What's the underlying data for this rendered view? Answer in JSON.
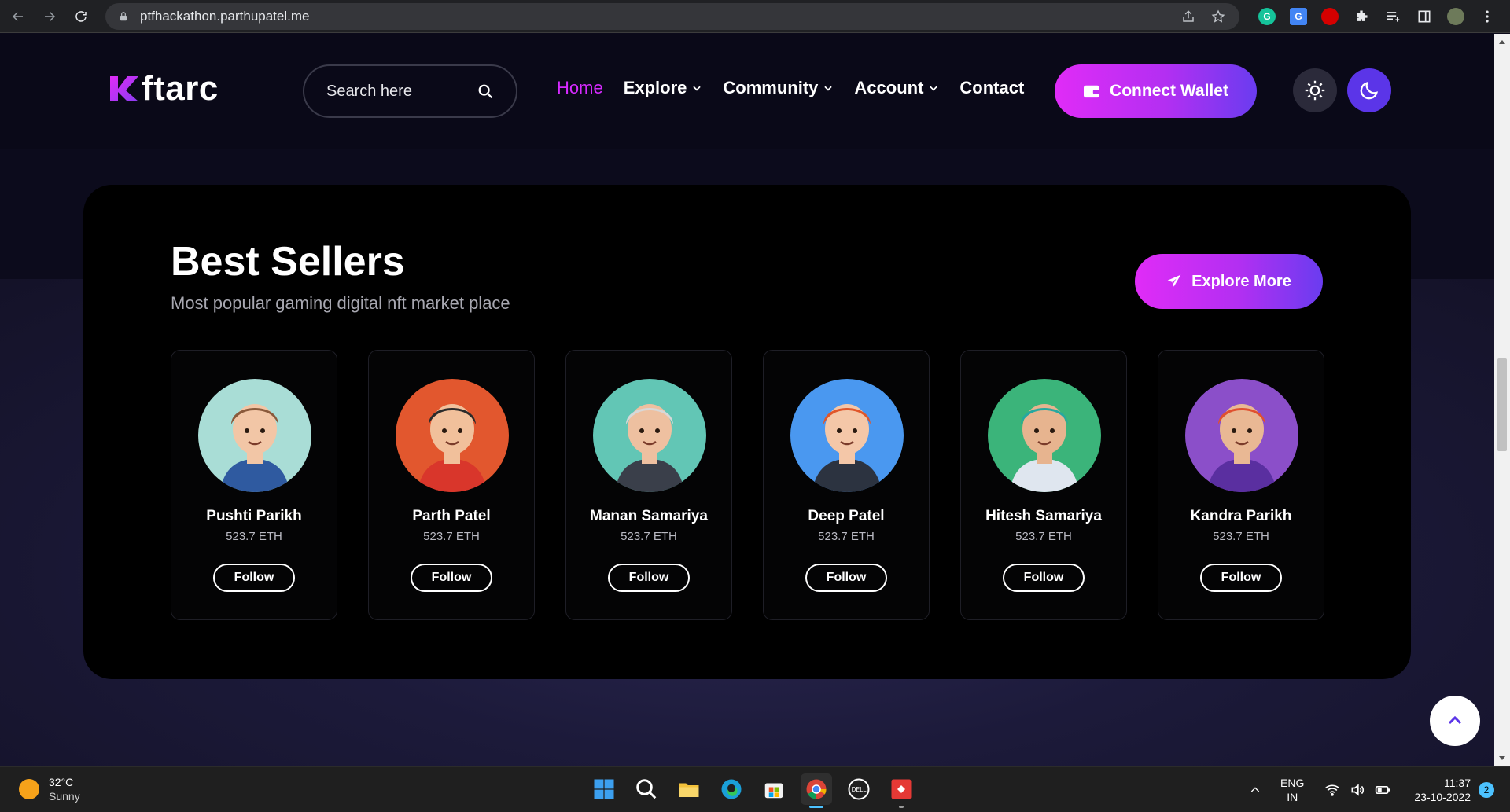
{
  "browser": {
    "url": "ptfhackathon.parthupatel.me"
  },
  "site": {
    "logo_text": "ftarc",
    "search_placeholder": "Search here",
    "nav": [
      {
        "label": "Home"
      },
      {
        "label": "Explore"
      },
      {
        "label": "Community"
      },
      {
        "label": "Account"
      },
      {
        "label": "Contact"
      }
    ],
    "connect_label": "Connect Wallet"
  },
  "best_sellers": {
    "title": "Best Sellers",
    "subtitle": "Most popular gaming digital nft market place",
    "explore_label": "Explore More",
    "sellers": [
      {
        "name": "Pushti Parikh",
        "eth": "523.7 ETH",
        "follow": "Follow",
        "bg": "#a9ddd6",
        "hair": "#8a5a3c",
        "skin": "#f2c6a6",
        "shirt": "#2f5aa0"
      },
      {
        "name": "Parth Patel",
        "eth": "523.7 ETH",
        "follow": "Follow",
        "bg": "#e2572e",
        "hair": "#2b2b2b",
        "skin": "#f1c09b",
        "shirt": "#d9362b"
      },
      {
        "name": "Manan Samariya",
        "eth": "523.7 ETH",
        "follow": "Follow",
        "bg": "#62c6b5",
        "hair": "#d8d8d8",
        "skin": "#eec0a0",
        "shirt": "#3a3f4a"
      },
      {
        "name": "Deep Patel",
        "eth": "523.7 ETH",
        "follow": "Follow",
        "bg": "#4a98f0",
        "hair": "#e0562a",
        "skin": "#f4c7a8",
        "shirt": "#2c3340"
      },
      {
        "name": "Hitesh Samariya",
        "eth": "523.7 ETH",
        "follow": "Follow",
        "bg": "#3bb47a",
        "hair": "#27a8a0",
        "skin": "#e7b48f",
        "shirt": "#dfe6ef"
      },
      {
        "name": "Kandra Parikh",
        "eth": "523.7 ETH",
        "follow": "Follow",
        "bg": "#8b4fc9",
        "hair": "#e0502f",
        "skin": "#e9b894",
        "shirt": "#5a2fa0"
      }
    ]
  },
  "taskbar": {
    "temp": "32°C",
    "condition": "Sunny",
    "lang_top": "ENG",
    "lang_bottom": "IN",
    "time": "11:37",
    "date": "23-10-2022",
    "notifications": "2"
  },
  "icons": {
    "back": "back-arrow-icon",
    "forward": "forward-arrow-icon",
    "reload": "reload-icon",
    "lock": "lock-icon",
    "share": "share-icon",
    "bookmark": "star-icon",
    "search": "search-icon",
    "wallet": "wallet-icon",
    "sun": "sun-icon",
    "moon": "moon-icon",
    "send": "paper-plane-icon",
    "scroll_top": "chevron-up-icon"
  },
  "colors": {
    "accent_pink": "#e02cf7",
    "accent_purple": "#6a3cf0",
    "active_nav": "#d62aff"
  }
}
